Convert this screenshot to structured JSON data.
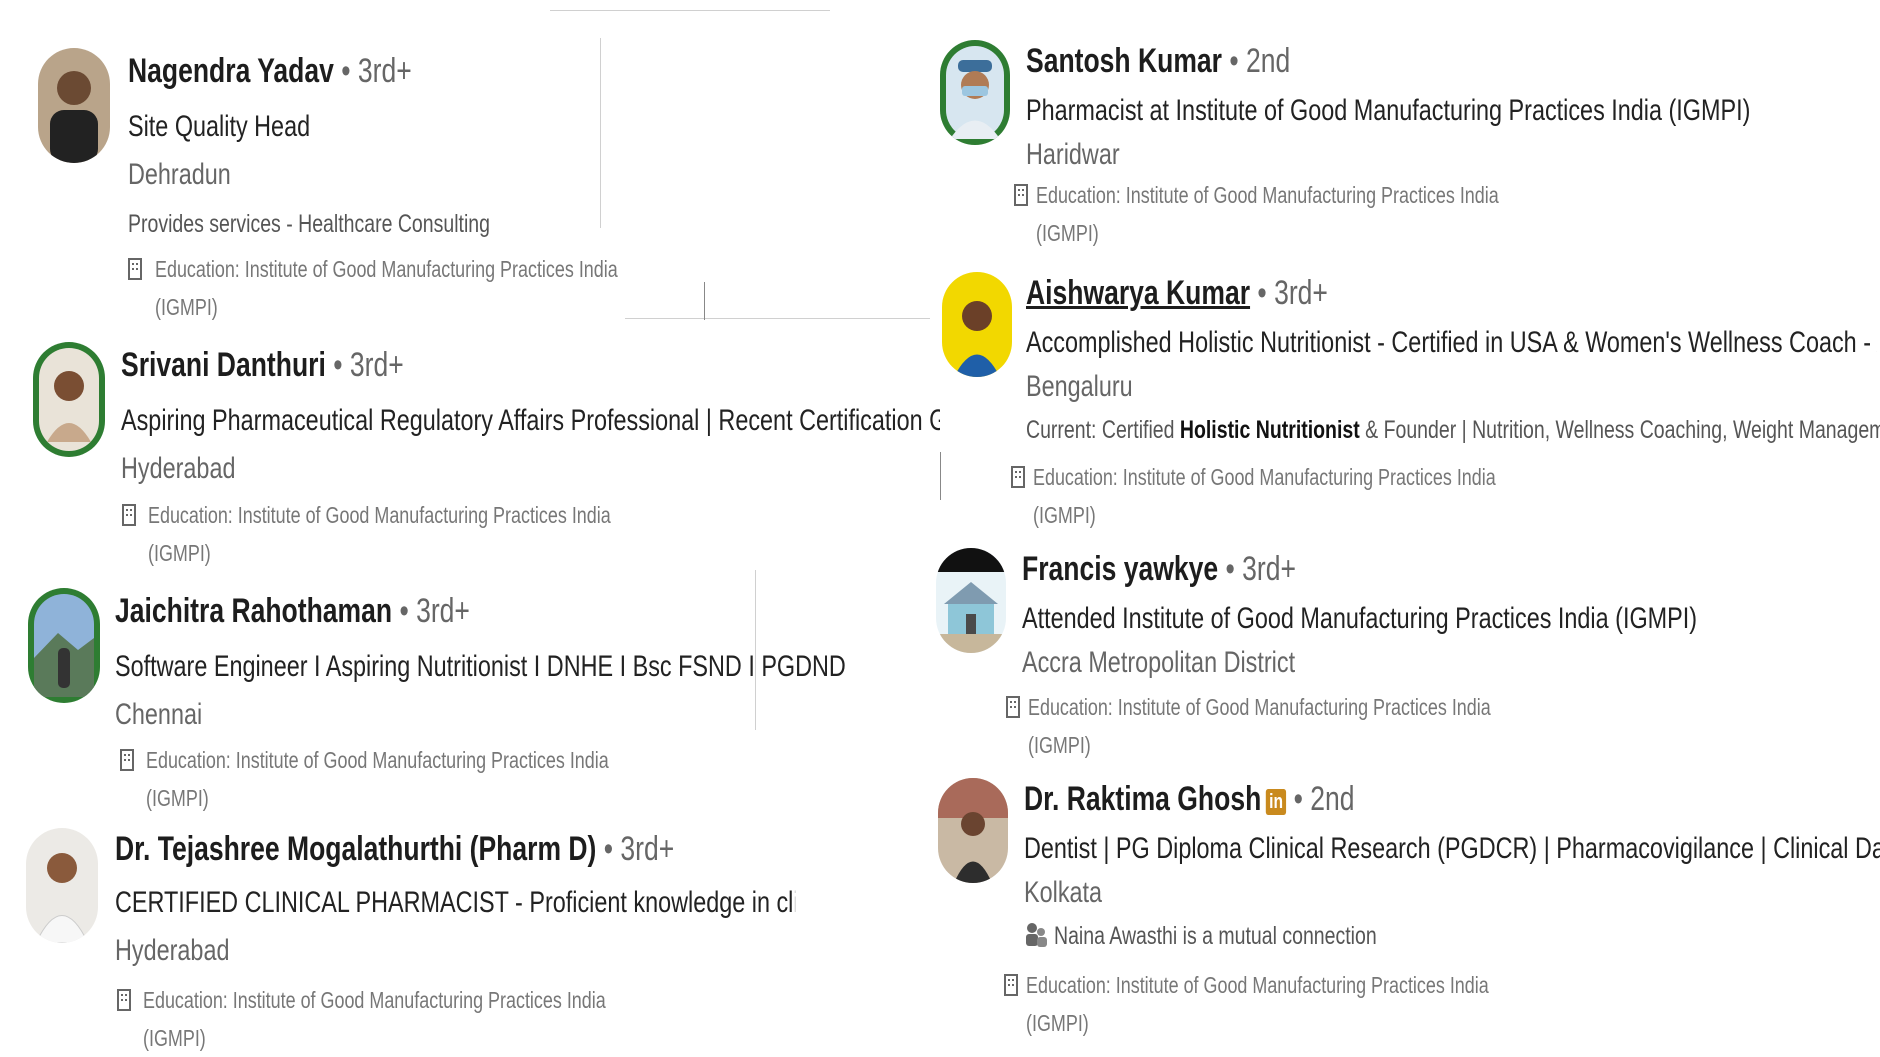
{
  "degree_sep": "•",
  "left": [
    {
      "name": "Nagendra Yadav",
      "degree": "3rd+",
      "headline": "Site Quality Head",
      "location": "Dehradun",
      "extra": "Provides services - Healthcare Consulting",
      "edu1": "Education: Institute of Good Manufacturing Practices India",
      "edu2": "(IGMPI)"
    },
    {
      "name": "Srivani Danthuri",
      "degree": "3rd+",
      "headline": "Aspiring Pharmaceutical Regulatory Affairs Professional | Recent Certification Graduate in...",
      "location": "Hyderabad",
      "edu1": "Education: Institute of Good Manufacturing Practices India",
      "edu2": "(IGMPI)"
    },
    {
      "name": "Jaichitra Rahothaman",
      "degree": "3rd+",
      "headline": "Software Engineer I Aspiring Nutritionist I DNHE I Bsc FSND I PGDND",
      "location": "Chennai",
      "edu1": "Education: Institute of Good Manufacturing Practices India",
      "edu2": "(IGMPI)"
    },
    {
      "name": "Dr. Tejashree Mogalathurthi (Pharm D)",
      "degree": "3rd+",
      "headline": "CERTIFIED CLINICAL PHARMACIST - Proficient knowledge in clinical pharmacology, medica",
      "location": "Hyderabad",
      "edu1": "Education: Institute of Good Manufacturing Practices India",
      "edu2": "(IGMPI)"
    }
  ],
  "right": [
    {
      "name": "Santosh Kumar",
      "degree": "2nd",
      "headline": "Pharmacist at Institute of Good Manufacturing Practices India (IGMPI)",
      "location": "Haridwar",
      "edu1": "Education: Institute of Good Manufacturing Practices India",
      "edu2": "(IGMPI)"
    },
    {
      "name": "Aishwarya Kumar",
      "degree": "3rd+",
      "headline": "Accomplished Holistic Nutritionist - Certified in USA & Women's Wellness Coach - AYUSH, India...",
      "location": "Bengaluru",
      "current_prefix": "Current: Certified ",
      "current_bold": "Holistic Nutritionist",
      "current_suffix": " & Founder | Nutrition, Wellness Coaching, Weight Management...",
      "edu1": "Education: Institute of Good Manufacturing Practices India",
      "edu2": "(IGMPI)"
    },
    {
      "name": "Francis yawkye",
      "degree": "3rd+",
      "headline": "Attended Institute of Good Manufacturing Practices India (IGMPI)",
      "location": "Accra Metropolitan District",
      "edu1": "Education: Institute of Good Manufacturing Practices India",
      "edu2": "(IGMPI)"
    },
    {
      "name": "Dr. Raktima Ghosh",
      "badge": "in",
      "degree": "2nd",
      "headline": "Dentist | PG Diploma Clinical Research (PGDCR) | Pharmacovigilance | Clinical Data...",
      "location": "Kolkata",
      "mutual": "Naina Awasthi is a mutual connection",
      "edu1": "Education: Institute of Good Manufacturing Practices India",
      "edu2": "(IGMPI)"
    }
  ],
  "colors": {
    "name": "#1d1d1d",
    "secondary": "#666666",
    "badge": "#c98a1e",
    "ring_green": "#2e7d32"
  }
}
